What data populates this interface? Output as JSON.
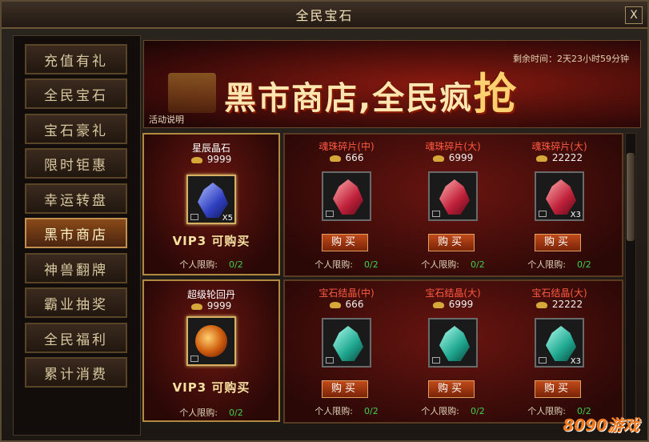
{
  "window": {
    "title": "全民宝石",
    "close_label": "X"
  },
  "sidebar": {
    "items": [
      {
        "label": "充值有礼"
      },
      {
        "label": "全民宝石"
      },
      {
        "label": "宝石豪礼"
      },
      {
        "label": "限时钜惠"
      },
      {
        "label": "幸运转盘"
      },
      {
        "label": "黑市商店",
        "active": true
      },
      {
        "label": "神兽翻牌"
      },
      {
        "label": "霸业抽奖"
      },
      {
        "label": "全民福利"
      },
      {
        "label": "累计消费"
      }
    ]
  },
  "banner": {
    "headline": "黑市商店,全民疯",
    "headline_big": "抢",
    "timer": "剩余时间：2天23小时59分钟",
    "activity_link": "活动说明"
  },
  "featured": [
    {
      "name": "星辰晶石",
      "price": "9999",
      "badge": "X5",
      "vip": "VIP3  可购买",
      "limit_label": "个人限购:",
      "limit_value": "0/2",
      "icon": "blue-crystal-icon"
    },
    {
      "name": "超级轮回丹",
      "price": "9999",
      "badge": "",
      "vip": "VIP3  可购买",
      "limit_label": "个人限购:",
      "limit_value": "0/2",
      "icon": "golden-orb-icon"
    }
  ],
  "rows": [
    [
      {
        "name": "魂珠碎片(中)",
        "price": "666",
        "badge": "",
        "buy": "购买",
        "limit_label": "个人限购:",
        "limit_value": "0/2",
        "color": "red"
      },
      {
        "name": "魂珠碎片(大)",
        "price": "6999",
        "badge": "",
        "buy": "购买",
        "limit_label": "个人限购:",
        "limit_value": "0/2",
        "color": "red"
      },
      {
        "name": "魂珠碎片(大)",
        "price": "22222",
        "badge": "X3",
        "buy": "购买",
        "limit_label": "个人限购:",
        "limit_value": "0/2",
        "color": "red"
      }
    ],
    [
      {
        "name": "宝石结晶(中)",
        "price": "666",
        "badge": "",
        "buy": "购买",
        "limit_label": "个人限购:",
        "limit_value": "0/2",
        "color": "teal"
      },
      {
        "name": "宝石结晶(大)",
        "price": "6999",
        "badge": "",
        "buy": "购买",
        "limit_label": "个人限购:",
        "limit_value": "0/2",
        "color": "teal"
      },
      {
        "name": "宝石结晶(大)",
        "price": "22222",
        "badge": "X3",
        "buy": "购买",
        "limit_label": "个人限购:",
        "limit_value": "0/2",
        "color": "teal"
      }
    ]
  ],
  "watermark": "8090游戏",
  "colors": {
    "accent_gold": "#b08a40",
    "limit_green": "#3fd04a",
    "item_name_red": "#ff5a40"
  }
}
